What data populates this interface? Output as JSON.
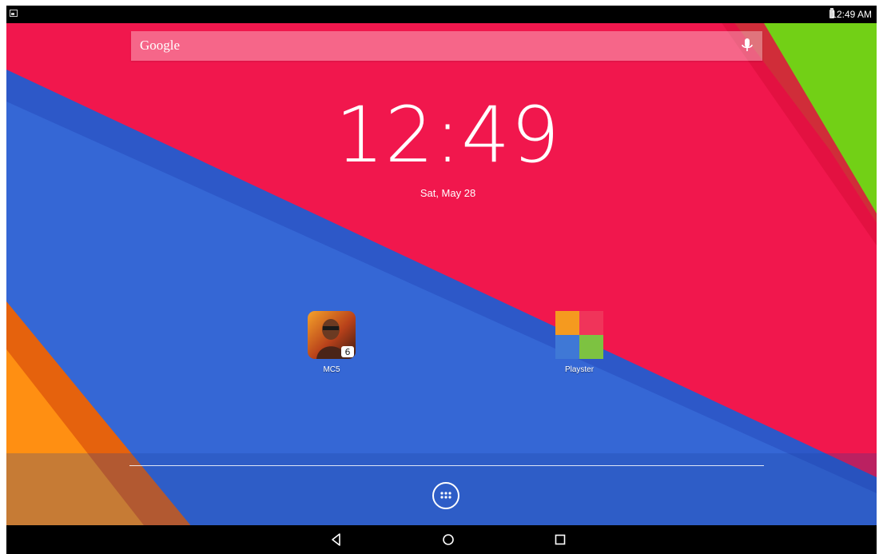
{
  "status_bar": {
    "left_icon": "screenshot-icon",
    "battery_icon": "battery-icon",
    "time": "12:49 AM"
  },
  "search": {
    "brand": "Google",
    "mic_icon": "mic-icon"
  },
  "clock": {
    "time": "12:49",
    "date": "Sat, May 28"
  },
  "apps": [
    {
      "label": "MC5",
      "icon": "mc5-app-icon"
    },
    {
      "label": "Playster",
      "icon": "playster-app-icon"
    }
  ],
  "dock": {
    "all_apps_icon": "app-drawer-icon"
  },
  "nav_bar": {
    "back_icon": "back-icon",
    "home_icon": "home-icon",
    "recents_icon": "recents-icon"
  },
  "colors": {
    "wallpaper_red": "#f1174d",
    "wallpaper_blue": "#3166d6",
    "wallpaper_green": "#6fd014",
    "wallpaper_orange": "#ff8c10",
    "bars": "#000000"
  }
}
